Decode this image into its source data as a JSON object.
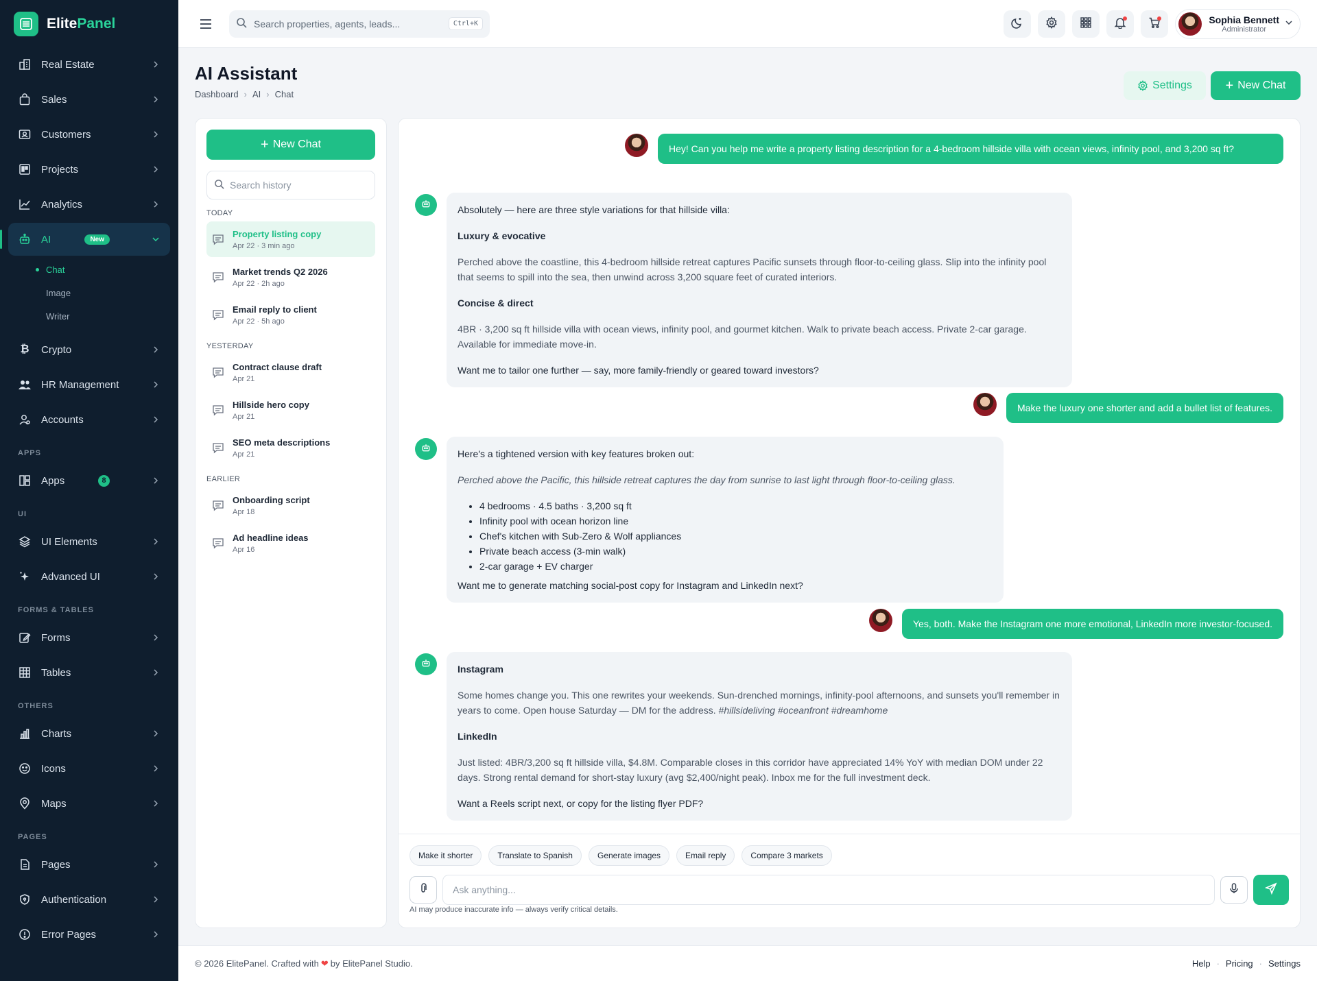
{
  "brand": {
    "name_primary": "Elite",
    "name_accent": "Panel",
    "accent": "#1fbf87"
  },
  "sidebar": {
    "items": [
      {
        "label": "Real Estate",
        "icon": "building-icon"
      },
      {
        "label": "Sales",
        "icon": "shopping-bag-icon"
      },
      {
        "label": "Customers",
        "icon": "id-card-icon"
      },
      {
        "label": "Projects",
        "icon": "kanban-icon"
      },
      {
        "label": "Analytics",
        "icon": "line-chart-icon"
      },
      {
        "label": "AI",
        "icon": "robot-icon",
        "badge": "New",
        "active": true,
        "children": [
          {
            "label": "Chat",
            "active": true
          },
          {
            "label": "Image"
          },
          {
            "label": "Writer"
          }
        ]
      },
      {
        "label": "Crypto",
        "icon": "bitcoin-icon"
      },
      {
        "label": "HR Management",
        "icon": "users-icon"
      },
      {
        "label": "Accounts",
        "icon": "user-cog-icon"
      }
    ],
    "section_apps": "APPS",
    "apps": {
      "label": "Apps",
      "badge": "8",
      "icon": "grid-icon"
    },
    "section_ui": "UI",
    "ui_items": [
      {
        "label": "UI Elements",
        "icon": "layers-icon"
      },
      {
        "label": "Advanced UI",
        "icon": "sparkles-icon"
      }
    ],
    "section_forms": "FORMS & TABLES",
    "forms_items": [
      {
        "label": "Forms",
        "icon": "edit-icon"
      },
      {
        "label": "Tables",
        "icon": "table-icon"
      }
    ],
    "section_others": "OTHERS",
    "others_items": [
      {
        "label": "Charts",
        "icon": "bar-chart-icon"
      },
      {
        "label": "Icons",
        "icon": "smiley-icon"
      },
      {
        "label": "Maps",
        "icon": "map-pin-icon"
      }
    ],
    "section_pages": "PAGES",
    "pages_items": [
      {
        "label": "Pages",
        "icon": "file-icon"
      },
      {
        "label": "Authentication",
        "icon": "shield-icon"
      },
      {
        "label": "Error Pages",
        "icon": "alert-circle-icon"
      }
    ]
  },
  "header": {
    "search_placeholder": "Search properties, agents, leads...",
    "shortcut": "Ctrl+K",
    "user_name": "Sophia Bennett",
    "user_role": "Administrator"
  },
  "page": {
    "title": "AI Assistant",
    "breadcrumb": [
      "Dashboard",
      "AI",
      "Chat"
    ],
    "settings_label": "Settings",
    "new_chat_label": "New Chat"
  },
  "history": {
    "new_chat_label": "New Chat",
    "search_placeholder": "Search history",
    "groups": [
      {
        "label": "TODAY",
        "items": [
          {
            "title": "Property listing copy",
            "meta": "Apr 22 · 3 min ago",
            "active": true
          },
          {
            "title": "Market trends Q2 2026",
            "meta": "Apr 22 · 2h ago"
          },
          {
            "title": "Email reply to client",
            "meta": "Apr 22 · 5h ago"
          }
        ]
      },
      {
        "label": "YESTERDAY",
        "items": [
          {
            "title": "Contract clause draft",
            "meta": "Apr 21"
          },
          {
            "title": "Hillside hero copy",
            "meta": "Apr 21"
          },
          {
            "title": "SEO meta descriptions",
            "meta": "Apr 21"
          }
        ]
      },
      {
        "label": "EARLIER",
        "items": [
          {
            "title": "Onboarding script",
            "meta": "Apr 18"
          },
          {
            "title": "Ad headline ideas",
            "meta": "Apr 16"
          }
        ]
      }
    ]
  },
  "chat": {
    "messages": {
      "user1": "Hey! Can you help me write a property listing description for a 4-bedroom hillside villa with ocean views, infinity pool, and 3,200 sq ft?",
      "bot1": {
        "intro": "Absolutely — here are three style variations for that hillside villa:",
        "h1": "Luxury & evocative",
        "p1": "Perched above the coastline, this 4-bedroom hillside retreat captures Pacific sunsets through floor-to-ceiling glass. Slip into the infinity pool that seems to spill into the sea, then unwind across 3,200 square feet of curated interiors.",
        "h2": "Concise & direct",
        "p2": "4BR · 3,200 sq ft hillside villa with ocean views, infinity pool, and gourmet kitchen. Walk to private beach access. Private 2-car garage. Available for immediate move-in.",
        "outro": "Want me to tailor one further — say, more family-friendly or geared toward investors?"
      },
      "user2": "Make the luxury one shorter and add a bullet list of features.",
      "bot2": {
        "intro": "Here's a tightened version with key features broken out:",
        "quote": "Perched above the Pacific, this hillside retreat captures the day from sunrise to last light through floor-to-ceiling glass.",
        "bullets": [
          "4 bedrooms · 4.5 baths · 3,200 sq ft",
          "Infinity pool with ocean horizon line",
          "Chef's kitchen with Sub-Zero & Wolf appliances",
          "Private beach access (3-min walk)",
          "2-car garage + EV charger"
        ],
        "outro": "Want me to generate matching social-post copy for Instagram and LinkedIn next?"
      },
      "user3": "Yes, both. Make the Instagram one more emotional, LinkedIn more investor-focused.",
      "bot3": {
        "h1": "Instagram",
        "p1": "Some homes change you. This one rewrites your weekends. Sun-drenched mornings, infinity-pool afternoons, and sunsets you'll remember in years to come. Open house Saturday — DM for the address.",
        "tags": "#hillsideliving #oceanfront #dreamhome",
        "h2": "LinkedIn",
        "p2": "Just listed: 4BR/3,200 sq ft hillside villa, $4.8M. Comparable closes in this corridor have appreciated 14% YoY with median DOM under 22 days. Strong rental demand for short-stay luxury (avg $2,400/night peak). Inbox me for the full investment deck.",
        "outro": "Want a Reels script next, or copy for the listing flyer PDF?"
      }
    },
    "chips": [
      "Make it shorter",
      "Translate to Spanish",
      "Generate images",
      "Email reply",
      "Compare 3 markets"
    ],
    "input_placeholder": "Ask anything...",
    "disclaimer": "AI may produce inaccurate info — always verify critical details."
  },
  "footer": {
    "copyright_pre": "© 2026 ElitePanel. Crafted with",
    "copyright_post": "by ElitePanel Studio.",
    "links": [
      "Help",
      "Pricing",
      "Settings"
    ]
  }
}
